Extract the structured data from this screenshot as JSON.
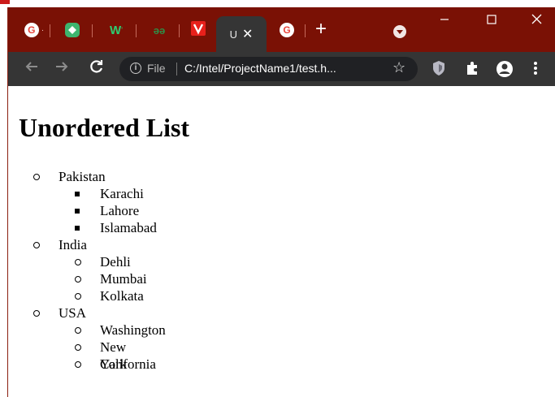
{
  "browser": {
    "tabs": [
      {
        "icon": "google-icon",
        "color": "#ffffff"
      },
      {
        "icon": "shield-green-icon",
        "color": "#3db56e"
      },
      {
        "icon": "w-icon",
        "color": "#2ecc71"
      },
      {
        "icon": "gfg-icon",
        "color": "#2f8d46"
      },
      {
        "icon": "v-icon",
        "color": "#e8201b"
      },
      {
        "active": true,
        "label": "U"
      },
      {
        "icon": "google-icon",
        "color": "#ffffff"
      }
    ],
    "address": {
      "scheme_label": "File",
      "url": "C:/Intel/ProjectName1/test.h..."
    },
    "theme": {
      "tabstrip": "#7a1105",
      "toolbar": "#353535"
    }
  },
  "page": {
    "heading": "Unordered List",
    "items": [
      {
        "label": "Pakistan",
        "children": [
          "Karachi",
          "Lahore",
          "Islamabad"
        ],
        "child_marker": "square"
      },
      {
        "label": "India",
        "children": [
          "Dehli",
          "Mumbai",
          "Kolkata"
        ],
        "child_marker": "circle"
      },
      {
        "label": "USA",
        "children": [
          "Washington",
          "New York",
          "California"
        ],
        "child_marker": "circle"
      }
    ]
  }
}
